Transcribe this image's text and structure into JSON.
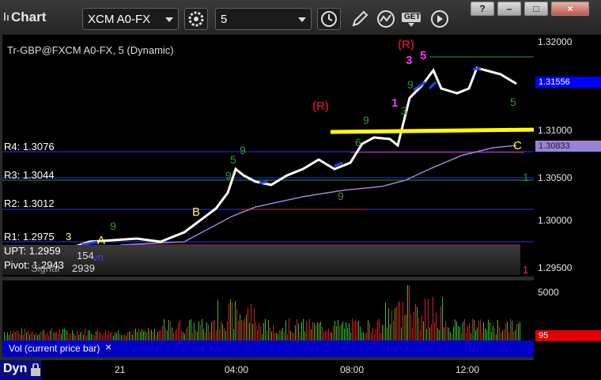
{
  "window": {
    "title": "Chart",
    "buttons": {
      "help": "?",
      "minimize": "–",
      "maximize": "□",
      "close": "×"
    }
  },
  "toolbar": {
    "symbol": "XCM A0-FX",
    "interval": "5",
    "get_label": "GET"
  },
  "chart": {
    "header": "Tr-GBP@FXCM A0-FX, 5 (Dynamic)",
    "price_axis": {
      "ticks": [
        "1.32000",
        "1.31556",
        "1.31000",
        "1.30833",
        "1.30500",
        "1.30000",
        "1.29500"
      ],
      "last_price": "1.31556",
      "avg_price": "1.30833"
    },
    "pivots": [
      {
        "label": "R4: 1.3076"
      },
      {
        "label": "R3: 1.3044"
      },
      {
        "label": "R2: 1.3012"
      },
      {
        "label": "R1: 1.2975"
      },
      {
        "label": "UPT: 1.2959"
      },
      {
        "label": "Pivot: 1.2943"
      }
    ],
    "overlay_texts": [
      "3",
      "154",
      "vn",
      "Signal",
      "2939",
      "2.939"
    ],
    "markers": {
      "r1": "(R)",
      "r2": "(R)",
      "a": "A",
      "b": "B",
      "c": "C",
      "n1": "1",
      "n3": "3",
      "n5": "5",
      "n9a": "9",
      "n9b": "9",
      "n9c": "9",
      "n9d": "9",
      "n5b": "5",
      "n1b": "1",
      "n1c": "1",
      "n6": "6",
      "n9e": "9",
      "n3b": "3",
      "n9f": "9",
      "n5c": "5"
    }
  },
  "volume": {
    "axis_label": "5000",
    "last_value": "95",
    "caption": "Vol (current price bar)",
    "close": "×"
  },
  "xaxis": {
    "labels": [
      "21",
      "04:00",
      "08:00",
      "12:00"
    ]
  },
  "status": {
    "dyn": "Dyn",
    "lock_icon": "lock-icon"
  },
  "colors": {
    "price_tag": "#0000ff",
    "avg_tag": "#9a82d8",
    "vol_tag": "#e00000",
    "trendline": "#ffff00"
  }
}
